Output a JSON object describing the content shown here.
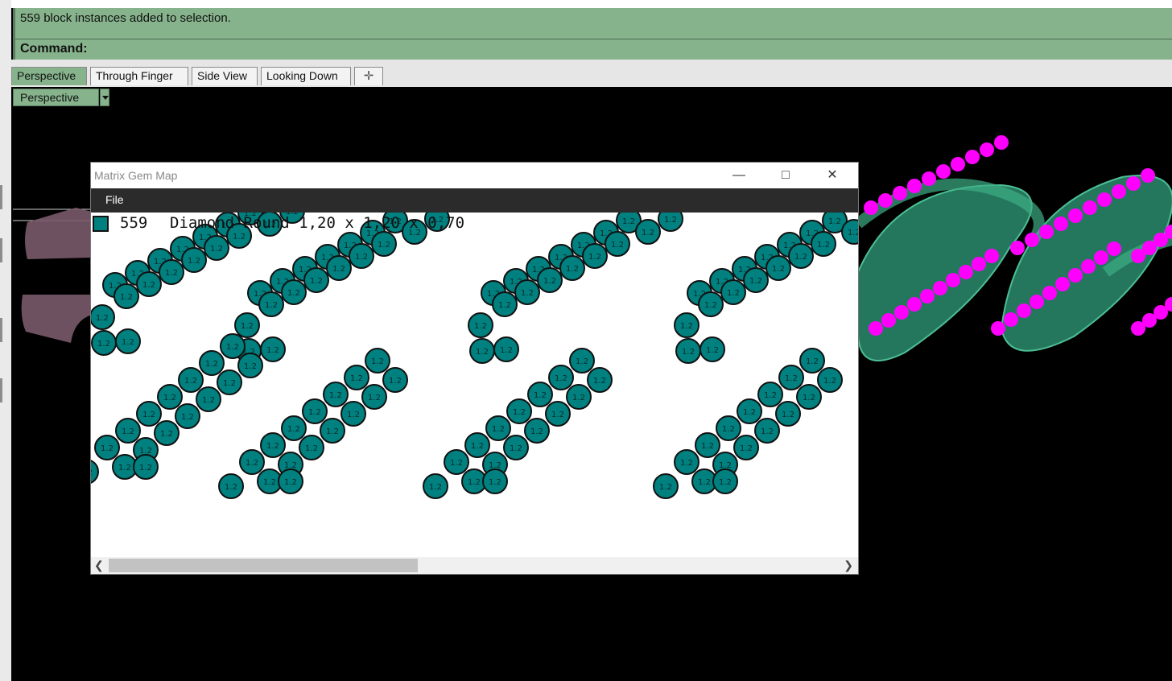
{
  "command_area": {
    "history_line": "559 block instances added to selection.",
    "prompt": "Command:"
  },
  "tabs": [
    {
      "label": "Perspective",
      "active": true
    },
    {
      "label": "Through Finger",
      "active": false
    },
    {
      "label": "Side View",
      "active": false
    },
    {
      "label": "Looking Down",
      "active": false
    }
  ],
  "tab_add_icon": "plus-icon",
  "viewport": {
    "label": "Perspective",
    "dropdown_icon": "triangle-down-icon"
  },
  "gem_map": {
    "title": "Matrix Gem Map",
    "menu": [
      "File"
    ],
    "legend": {
      "count": "559",
      "description": "Diamond-Round 1,20 x 1,20 x 0,70",
      "color": "#00807f"
    },
    "gem_label": "1.2",
    "window_icons": [
      "minimize-icon",
      "maximize-icon",
      "close-icon"
    ],
    "scroll_icons": [
      "chevron-left-icon",
      "chevron-right-icon"
    ]
  },
  "colors": {
    "command_green": "#86b38c",
    "gem_teal": "#00807f",
    "chain_green": "#2f8a6a",
    "stone_magenta": "#ff00ff"
  }
}
